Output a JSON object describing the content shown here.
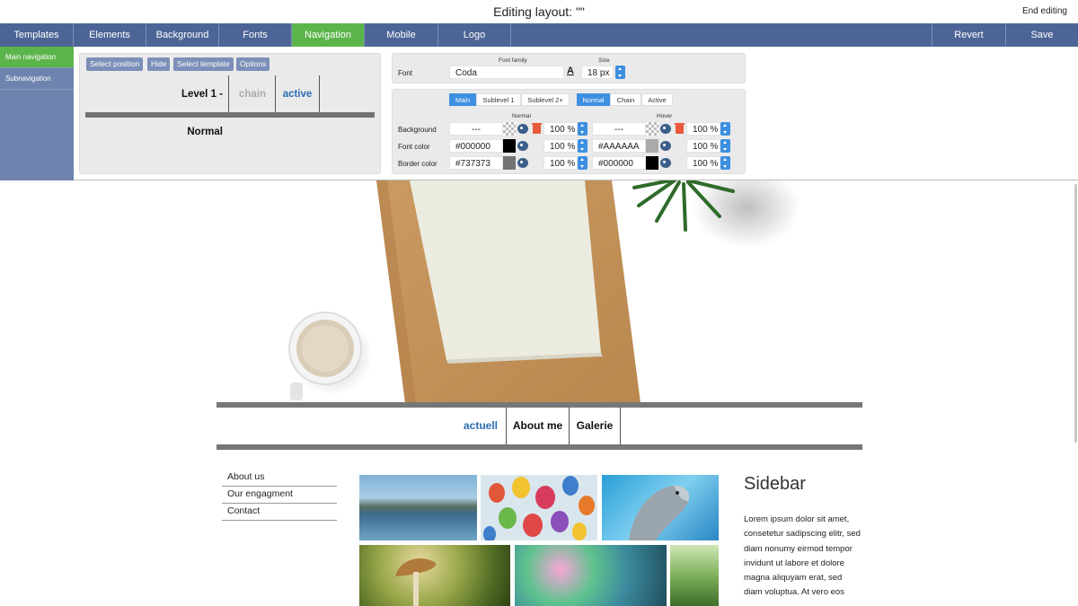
{
  "titlebar": {
    "title": "Editing layout: \"\"",
    "end_editing": "End editing"
  },
  "topnav": {
    "tabs": [
      "Templates",
      "Elements",
      "Background",
      "Fonts",
      "Navigation",
      "Mobile",
      "Logo"
    ],
    "active": "Navigation",
    "revert": "Revert",
    "save": "Save"
  },
  "leftnav": {
    "items": [
      "Main navigation",
      "Subnavigation"
    ],
    "active": "Main navigation"
  },
  "position_panel": {
    "buttons": [
      "Select position",
      "Hide",
      "Select template",
      "Options"
    ],
    "preview": {
      "normal": "Level 1 - Normal",
      "chain": "chain",
      "active": "active"
    }
  },
  "font_panel": {
    "font_label": "Font",
    "font_family_label": "Font family",
    "size_label": "Size",
    "font_family": "Coda",
    "size": "18 px"
  },
  "style_panel": {
    "level_tabs": [
      "Main",
      "Sublevel 1",
      "Sublevel 2+"
    ],
    "state_tabs": [
      "Normal",
      "Chain",
      "Active"
    ],
    "normal_header": "Normal",
    "hover_header": "Hover",
    "rows": [
      {
        "label": "Background",
        "normal_value": "---",
        "normal_opacity": "100 %",
        "hover_value": "---",
        "hover_opacity": "100 %"
      },
      {
        "label": "Font color",
        "normal_value": "#000000",
        "normal_opacity": "100 %",
        "hover_value": "#AAAAAA",
        "hover_opacity": "100 %"
      },
      {
        "label": "Border color",
        "normal_value": "#737373",
        "normal_opacity": "100 %",
        "hover_value": "#000000",
        "hover_opacity": "100 %"
      }
    ],
    "colors": {
      "black": "#000000",
      "grey": "#737373",
      "light_grey": "#AAAAAA",
      "accent": "#3d8fe0"
    }
  },
  "site": {
    "nav": [
      "actuell",
      "About me",
      "Galerie"
    ],
    "subnav": [
      "About us",
      "Our engagment",
      "Contact"
    ],
    "sidebar_title": "Sidebar",
    "sidebar_text": "Lorem ipsum dolor sit amet, consetetur sadipscing elitr, sed diam nonumy eirmod tempor invidunt ut labore et dolore magna aliquyam erat, sed diam voluptua. At vero eos"
  },
  "brand": {
    "nav_bg": "#4d6596",
    "active_tab": "#5cb54a",
    "link_active": "#2a6db0"
  }
}
